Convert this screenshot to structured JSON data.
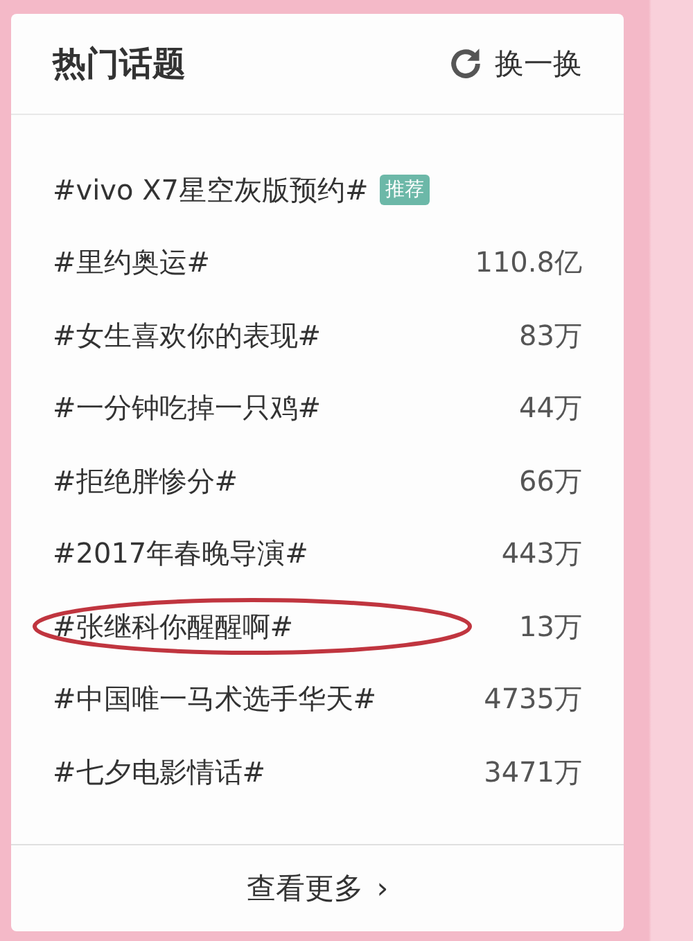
{
  "panel": {
    "title": "热门话题",
    "refresh": "换一换"
  },
  "topics": [
    {
      "title": "#vivo X7星空灰版预约#",
      "badge": "推荐",
      "circled": false
    },
    {
      "title": "#里约奥运#",
      "count": "110.8亿",
      "circled": false
    },
    {
      "title": "#女生喜欢你的表现#",
      "count": "83万",
      "circled": false
    },
    {
      "title": "#一分钟吃掉一只鸡#",
      "count": "44万",
      "circled": false
    },
    {
      "title": "#拒绝胖惨分#",
      "count": "66万",
      "circled": false
    },
    {
      "title": "#2017年春晚导演#",
      "count": "443万",
      "circled": false
    },
    {
      "title": "#张继科你醒醒啊#",
      "count": "13万",
      "circled": true
    },
    {
      "title": "#中国唯一马术选手华天#",
      "count": "4735万",
      "circled": false
    },
    {
      "title": "#七夕电影情话#",
      "count": "3471万",
      "circled": false
    }
  ],
  "footer": {
    "more": "查看更多",
    "chevron": "›"
  }
}
